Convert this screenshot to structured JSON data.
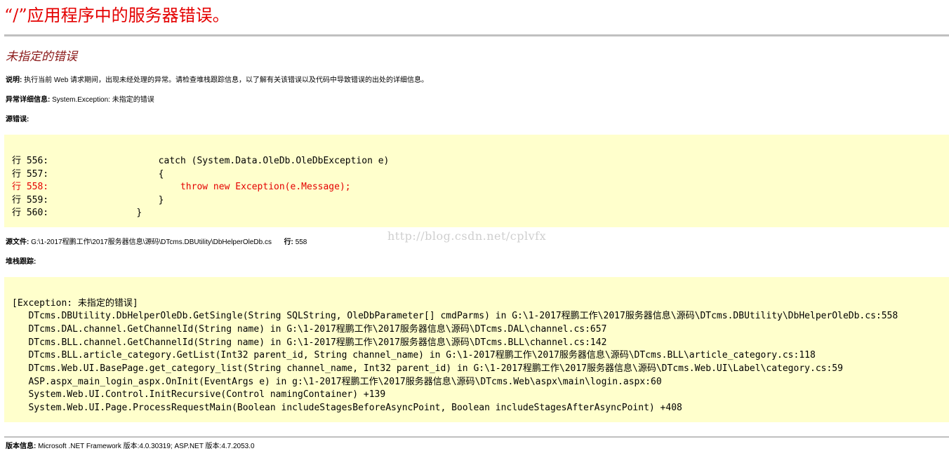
{
  "page": {
    "title": "“/”应用程序中的服务器错误。",
    "error_message": "未指定的错误"
  },
  "description": {
    "label": "说明:",
    "text": "执行当前 Web 请求期间，出现未经处理的异常。请检查堆栈跟踪信息，以了解有关该错误以及代码中导致错误的出处的详细信息。"
  },
  "exception_details": {
    "label": "异常详细信息:",
    "text": "System.Exception: 未指定的错误"
  },
  "source_error": {
    "label": "源错误:",
    "lines": [
      {
        "text": "行 556:                    catch (System.Data.OleDb.OleDbException e)",
        "error": false
      },
      {
        "text": "行 557:                    {",
        "error": false
      },
      {
        "text": "行 558:                        throw new Exception(e.Message);",
        "error": true
      },
      {
        "text": "行 559:                    }",
        "error": false
      },
      {
        "text": "行 560:                }",
        "error": false
      }
    ]
  },
  "source_file": {
    "label": "源文件:",
    "path": "G:\\1-2017程鹏工作\\2017服务器信息\\源码\\DTcms.DBUtility\\DbHelperOleDb.cs",
    "line_label": "行:",
    "line_value": "558"
  },
  "stack_trace": {
    "label": "堆栈跟踪:",
    "lines": [
      "[Exception: 未指定的错误]",
      "   DTcms.DBUtility.DbHelperOleDb.GetSingle(String SQLString, OleDbParameter[] cmdParms) in G:\\1-2017程鹏工作\\2017服务器信息\\源码\\DTcms.DBUtility\\DbHelperOleDb.cs:558",
      "   DTcms.DAL.channel.GetChannelId(String name) in G:\\1-2017程鹏工作\\2017服务器信息\\源码\\DTcms.DAL\\channel.cs:657",
      "   DTcms.BLL.channel.GetChannelId(String name) in G:\\1-2017程鹏工作\\2017服务器信息\\源码\\DTcms.BLL\\channel.cs:142",
      "   DTcms.BLL.article_category.GetList(Int32 parent_id, String channel_name) in G:\\1-2017程鹏工作\\2017服务器信息\\源码\\DTcms.BLL\\article_category.cs:118",
      "   DTcms.Web.UI.BasePage.get_category_list(String channel_name, Int32 parent_id) in G:\\1-2017程鹏工作\\2017服务器信息\\源码\\DTcms.Web.UI\\Label\\category.cs:59",
      "   ASP.aspx_main_login_aspx.OnInit(EventArgs e) in g:\\1-2017程鹏工作\\2017服务器信息\\源码\\DTcms.Web\\aspx\\main\\login.aspx:60",
      "   System.Web.UI.Control.InitRecursive(Control namingContainer) +139",
      "   System.Web.UI.Page.ProcessRequestMain(Boolean includeStagesBeforeAsyncPoint, Boolean includeStagesAfterAsyncPoint) +408"
    ]
  },
  "version_info": {
    "label": "版本信息:",
    "text": "Microsoft .NET Framework 版本:4.0.30319; ASP.NET 版本:4.7.2053.0"
  },
  "watermark": "http://blog.csdn.net/cplvfx",
  "colors": {
    "title_red": "#e40000",
    "subtitle_maroon": "#8b1a1a",
    "code_background": "#ffffcc",
    "rule_gray": "#c0c0c0"
  }
}
